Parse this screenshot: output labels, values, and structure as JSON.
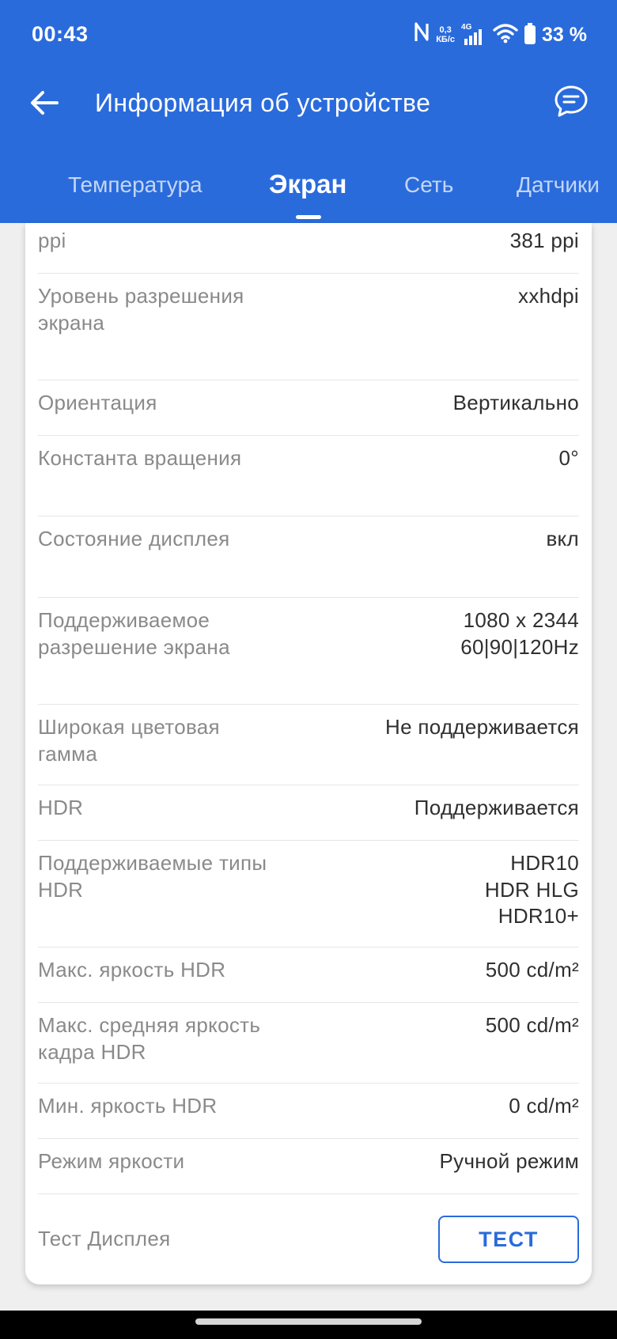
{
  "status_bar": {
    "time": "00:43",
    "speed_value": "0,3",
    "speed_unit": "КБ/с",
    "network_type": "4G",
    "battery": "33 %"
  },
  "app_bar": {
    "title": "Информация об устройстве"
  },
  "tabs": [
    {
      "label": "Температура",
      "active": false
    },
    {
      "label": "Экран",
      "active": true
    },
    {
      "label": "Сеть",
      "active": false
    },
    {
      "label": "Датчики",
      "active": false
    }
  ],
  "rows": [
    {
      "label": "ppi",
      "value": "381 ppi"
    },
    {
      "label": "Уровень разрешения экрана",
      "value": "xxhdpi"
    },
    {
      "label": "Ориентация",
      "value": "Вертикально"
    },
    {
      "label": "Константа вращения",
      "value": "0°"
    },
    {
      "label": "Состояние дисплея",
      "value": "вкл"
    },
    {
      "label": "Поддерживаемое разрешение экрана",
      "value": "1080 x 2344\n60|90|120Hz"
    },
    {
      "label": "Широкая цветовая гамма",
      "value": "Не поддерживается"
    },
    {
      "label": "HDR",
      "value": "Поддерживается"
    },
    {
      "label": "Поддерживаемые типы HDR",
      "value": "HDR10\nHDR HLG\nHDR10+"
    },
    {
      "label": "Макс. яркость HDR",
      "value": "500 cd/m²"
    },
    {
      "label": "Макс. средняя яркость кадра HDR",
      "value": "500 cd/m²"
    },
    {
      "label": "Мин. яркость HDR",
      "value": "0 cd/m²"
    },
    {
      "label": "Режим яркости",
      "value": "Ручной режим"
    }
  ],
  "display_test": {
    "label": "Тест Дисплея",
    "button_label": "ТЕСТ"
  },
  "colors": {
    "primary": "#2a6bdc",
    "label_text": "#8a8a8a",
    "value_text": "#2f2f2f"
  }
}
